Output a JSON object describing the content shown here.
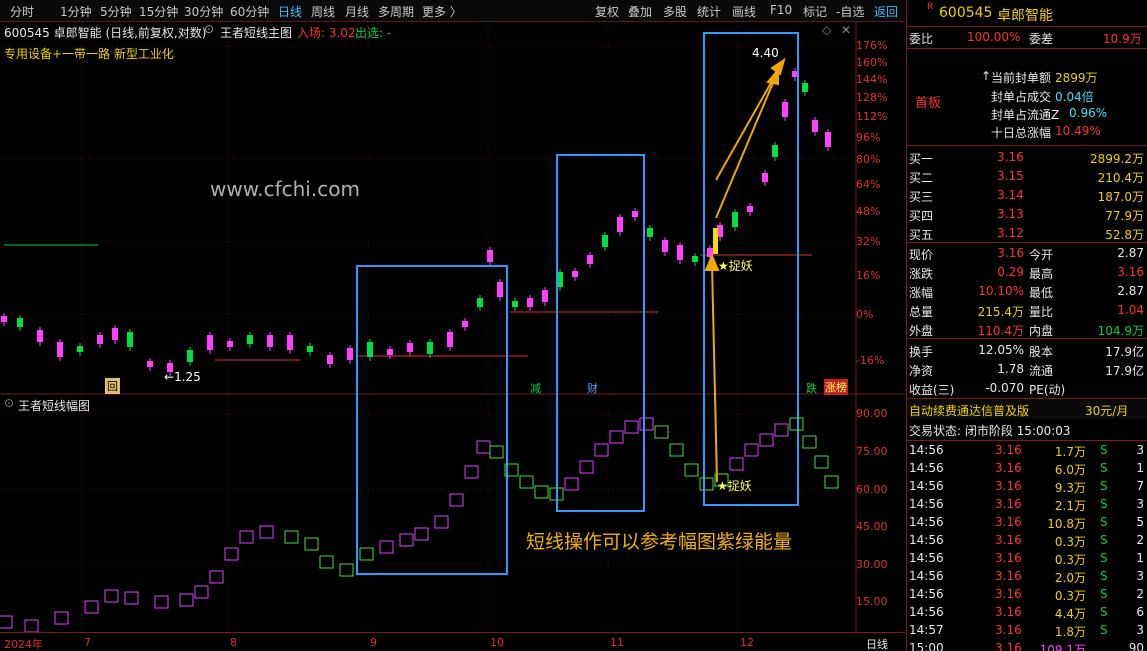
{
  "toolbar": {
    "items": [
      "分时",
      "1分钟",
      "5分钟",
      "15分钟",
      "30分钟",
      "60分钟",
      "日线",
      "周线",
      "月线",
      "多周期",
      "更多 〉"
    ],
    "active": "日线",
    "right_items": [
      "复权",
      "叠加",
      "多股",
      "统计",
      "画线",
      "F10",
      "标记",
      "-自选",
      "返回"
    ]
  },
  "main_title": {
    "stock": "600545 卓郎智能 (日线,前复权,对数)",
    "indicator": "王者短线主图",
    "entry": "入场: 3.02",
    "exit": "出选: -"
  },
  "concept_tags": "专用设备+一带一路 新型工业化",
  "watermark": "www.cfchi.com",
  "price_axis": [
    "176%",
    "160%",
    "144%",
    "128%",
    "112%",
    "96%",
    "80%",
    "64%",
    "48%",
    "32%",
    "16%",
    "0%",
    "-16%"
  ],
  "annotations": {
    "peak": "4.40",
    "low": "1.25",
    "zhuoyao_main": "★捉妖",
    "zhuoyao_sub": "★捉妖",
    "badges": [
      "回",
      "减",
      "财",
      "跌",
      "涨榜"
    ]
  },
  "sub_chart": {
    "title": "王者短线幅图",
    "axis": [
      "90.00",
      "75.00",
      "60.00",
      "45.00",
      "30.00",
      "15.00"
    ],
    "caption": "短线操作可以参考幅图紫绿能量"
  },
  "date_axis": {
    "labels": [
      "2024年",
      "7",
      "8",
      "9",
      "10",
      "11",
      "12"
    ],
    "period": "日线"
  },
  "panel": {
    "code": "600545",
    "name": "卓郎智能",
    "weibi_label": "委比",
    "weibi": "100.00%",
    "weicha_label": "委差",
    "weicha": "10.9万",
    "shouban": "首板",
    "seal_info": [
      {
        "label": "当前封单额",
        "value": "2899万"
      },
      {
        "label": "封单占成交",
        "value": "0.04倍"
      },
      {
        "label": "封单占流通Z",
        "value": "0.96%"
      },
      {
        "label": "十日总涨幅",
        "value": "10.49%"
      }
    ],
    "bids": [
      {
        "label": "买一",
        "price": "3.16",
        "vol": "2899.2万"
      },
      {
        "label": "买二",
        "price": "3.15",
        "vol": "210.4万"
      },
      {
        "label": "买三",
        "price": "3.14",
        "vol": "187.0万"
      },
      {
        "label": "买四",
        "price": "3.13",
        "vol": "77.9万"
      },
      {
        "label": "买五",
        "price": "3.12",
        "vol": "52.8万"
      }
    ],
    "stats": [
      {
        "l1": "现价",
        "v1": "3.16",
        "l2": "今开",
        "v2": "2.87"
      },
      {
        "l1": "涨跌",
        "v1": "0.29",
        "l2": "最高",
        "v2": "3.16"
      },
      {
        "l1": "涨幅",
        "v1": "10.10%",
        "l2": "最低",
        "v2": "2.87"
      },
      {
        "l1": "总量",
        "v1": "215.4万",
        "l2": "量比",
        "v2": "1.04"
      },
      {
        "l1": "外盘",
        "v1": "110.4万",
        "l2": "内盘",
        "v2": "104.9万"
      }
    ],
    "stats2": [
      {
        "l1": "换手",
        "v1": "12.05%",
        "l2": "股本",
        "v2": "17.9亿"
      },
      {
        "l1": "净资",
        "v1": "1.78",
        "l2": "流通",
        "v2": "17.9亿"
      },
      {
        "l1": "收益(三)",
        "v1": "-0.070",
        "l2": "PE(动)",
        "v2": ""
      }
    ],
    "promo": "自动续费通达信普及版",
    "promo_price": "30元/月",
    "trade_status": "交易状态: 闭市阶段 15:00:03",
    "ticks": [
      {
        "t": "14:56",
        "p": "3.16",
        "v": "1.7万",
        "s": "S",
        "n": "3"
      },
      {
        "t": "14:56",
        "p": "3.16",
        "v": "6.0万",
        "s": "S",
        "n": "1"
      },
      {
        "t": "14:56",
        "p": "3.16",
        "v": "9.3万",
        "s": "S",
        "n": "7"
      },
      {
        "t": "14:56",
        "p": "3.16",
        "v": "2.1万",
        "s": "S",
        "n": "3"
      },
      {
        "t": "14:56",
        "p": "3.16",
        "v": "10.8万",
        "s": "S",
        "n": "5"
      },
      {
        "t": "14:56",
        "p": "3.16",
        "v": "0.3万",
        "s": "S",
        "n": "2"
      },
      {
        "t": "14:56",
        "p": "3.16",
        "v": "0.3万",
        "s": "S",
        "n": "1"
      },
      {
        "t": "14:56",
        "p": "3.16",
        "v": "2.0万",
        "s": "S",
        "n": "3"
      },
      {
        "t": "14:56",
        "p": "3.16",
        "v": "0.3万",
        "s": "S",
        "n": "2"
      },
      {
        "t": "14:56",
        "p": "3.16",
        "v": "4.4万",
        "s": "S",
        "n": "6"
      },
      {
        "t": "14:57",
        "p": "3.16",
        "v": "1.8万",
        "s": "S",
        "n": "3"
      },
      {
        "t": "15:00",
        "p": "3.16",
        "v": "109.1万",
        "s": "",
        "n": "90"
      }
    ]
  }
}
